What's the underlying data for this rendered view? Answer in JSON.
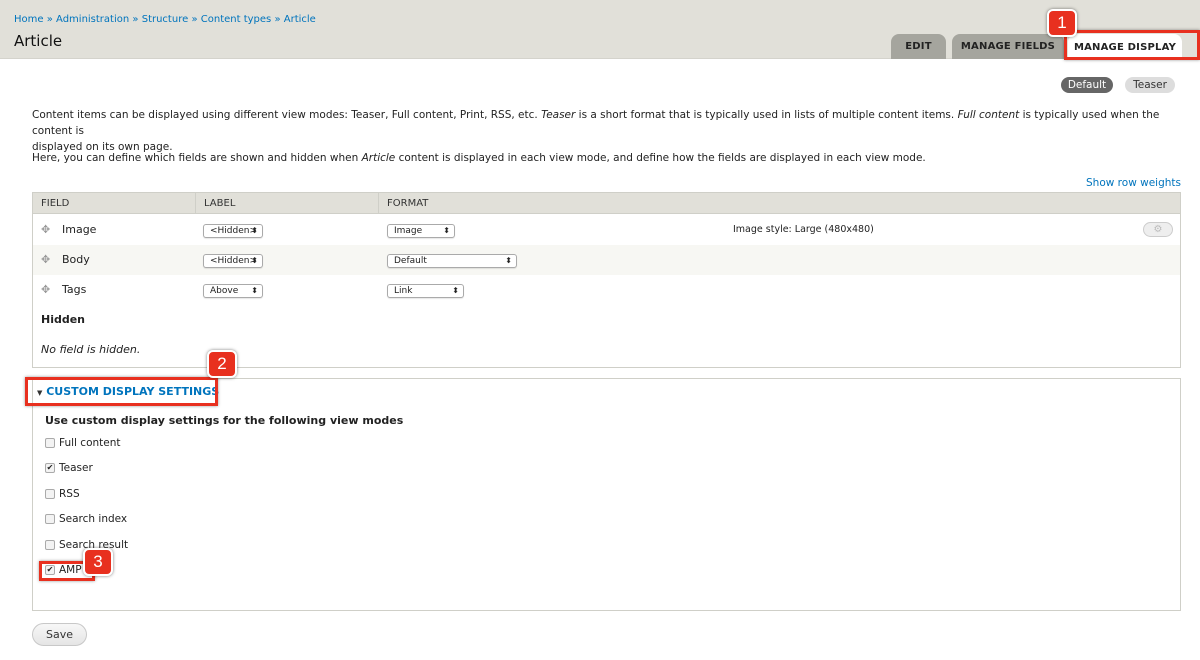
{
  "breadcrumb": [
    "Home",
    "Administration",
    "Structure",
    "Content types",
    "Article"
  ],
  "breadcrumb_sep": "»",
  "page_title": "Article",
  "tabs": [
    {
      "label": "EDIT"
    },
    {
      "label": "MANAGE FIELDS"
    },
    {
      "label": "MANAGE DISPLAY",
      "active": true
    }
  ],
  "view_modes": [
    {
      "label": "Default",
      "active": true
    },
    {
      "label": "Teaser"
    }
  ],
  "intro": {
    "p1a": "Content items can be displayed using different view modes: Teaser, Full content, Print, RSS, etc. ",
    "p1b": "Teaser",
    "p1c": " is a short format that is typically used in lists of multiple content items. ",
    "p1d": "Full content",
    "p1e": " is typically used when the content is",
    "p1f": "displayed on its own page.",
    "p2a": "Here, you can define which fields are shown and hidden when ",
    "p2b": "Article",
    "p2c": " content is displayed in each view mode, and define how the fields are displayed in each view mode."
  },
  "show_row_weights": "Show row weights",
  "table": {
    "headers": [
      "FIELD",
      "LABEL",
      "FORMAT"
    ],
    "rows": [
      {
        "field": "Image",
        "label": "<Hidden>",
        "format": "Image",
        "summary": "Image style: Large (480x480)"
      },
      {
        "field": "Body",
        "label": "<Hidden>",
        "format": "Default"
      },
      {
        "field": "Tags",
        "label": "Above",
        "format": "Link"
      }
    ],
    "hidden_heading": "Hidden",
    "hidden_empty": "No field is hidden."
  },
  "custom_display": {
    "summary": "CUSTOM DISPLAY SETTINGS",
    "legend": "Use custom display settings for the following view modes",
    "options": [
      {
        "label": "Full content",
        "checked": false
      },
      {
        "label": "Teaser",
        "checked": true
      },
      {
        "label": "RSS",
        "checked": false
      },
      {
        "label": "Search index",
        "checked": false
      },
      {
        "label": "Search result",
        "checked": false
      },
      {
        "label": "AMP",
        "checked": true
      }
    ]
  },
  "save_label": "Save",
  "annotations": [
    "1",
    "2",
    "3"
  ],
  "colors": {
    "link": "#0074bd",
    "header_bg": "#e1e0d9",
    "annotation": "#e8301f"
  }
}
